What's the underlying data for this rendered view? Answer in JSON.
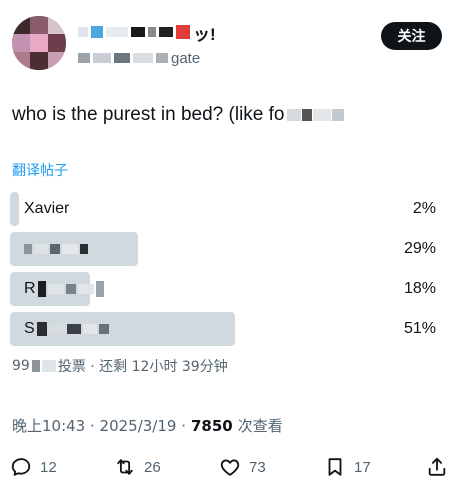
{
  "header": {
    "follow_label": "关注",
    "name_suffix": "ッ!",
    "handle_suffix": "gate"
  },
  "tweet": {
    "text": "who is the purest in bed? (like fo"
  },
  "translate_label": "翻译帖子",
  "poll": {
    "options": [
      {
        "label": "Xavier",
        "percent": 2,
        "percent_label": "2%"
      },
      {
        "label": "",
        "percent": 29,
        "percent_label": "29%"
      },
      {
        "label": "R",
        "percent": 18,
        "percent_label": "18%"
      },
      {
        "label": "S",
        "percent": 51,
        "percent_label": "51%"
      }
    ],
    "votes_prefix": "99",
    "votes_suffix": "投票 · 还剩 12小时 39分钟"
  },
  "meta": {
    "time_date": "晚上10:43 · 2025/3/19 ·",
    "views_count": "7850",
    "views_label": "次查看"
  },
  "actions": {
    "replies": "12",
    "retweets": "26",
    "likes": "73",
    "bookmarks": "17"
  },
  "colors": {
    "accent": "#1d9bf0",
    "bar": "#cfd9de",
    "text": "#0f1419",
    "muted": "#536471"
  }
}
